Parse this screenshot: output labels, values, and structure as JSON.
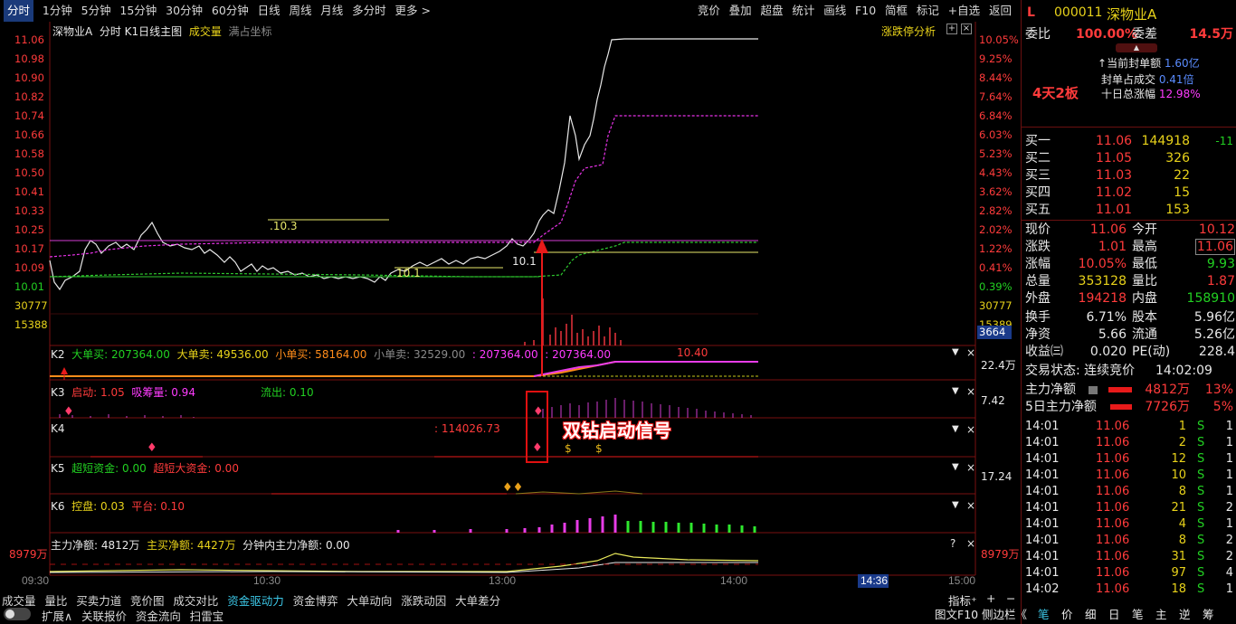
{
  "topbar": {
    "periods": [
      "分时",
      "1分钟",
      "5分钟",
      "15分钟",
      "30分钟",
      "60分钟",
      "日线",
      "周线",
      "月线",
      "多分时",
      "更多 >"
    ],
    "tools": [
      "竞价",
      "叠加",
      "超盘",
      "统计",
      "画线",
      "F10",
      "简框",
      "标记",
      "+自选",
      "返回"
    ]
  },
  "main": {
    "title_left": "深物业A",
    "title_mid": "分时  K1日线主图",
    "title_vol": "成交量",
    "title_coord": "满占坐标",
    "limit_analysis": "涨跌停分析",
    "price_ticks": [
      "11.06",
      "10.98",
      "10.90",
      "10.82",
      "10.74",
      "10.66",
      "10.58",
      "10.50",
      "10.41",
      "10.33",
      "10.25",
      "10.17",
      "10.09",
      "10.01"
    ],
    "pct_ticks": [
      "10.05%",
      "9.25%",
      "8.44%",
      "7.64%",
      "6.84%",
      "6.03%",
      "5.23%",
      "4.43%",
      "3.62%",
      "2.82%",
      "2.02%",
      "1.22%",
      "0.41%",
      "0.39%"
    ],
    "vol_ticks_left": [
      "30777",
      "15388"
    ],
    "vol_ticks_right": [
      "30777",
      "15389"
    ],
    "annot_1": ".10.3",
    "annot_2": "10.1",
    "annot_3": "10.1"
  },
  "panels": {
    "k2": {
      "label": "K2",
      "big_buy": "大单买: 207364.00",
      "big_sell": "大单卖: 49536.00",
      "small_buy": "小单买: 58164.00",
      "small_sell": "小单卖: 32529.00",
      "v1": ": 207364.00",
      "v2": ": 207364.00",
      "v3": "10.40",
      "right": "22.4万"
    },
    "k3": {
      "label": "K3",
      "start": "启动: 1.05",
      "absorb": "吸筹量: 0.94",
      "outflow": "流出: 0.10",
      "right": "7.42"
    },
    "k4": {
      "label": "K4",
      "val": ": 114026.73",
      "signal": "双钻启动信号"
    },
    "k5": {
      "label": "K5",
      "ultra": "超短资金: 0.00",
      "ultra_big": "超短大资金: 0.00",
      "right": "17.24"
    },
    "k6": {
      "label": "K6",
      "control": "控盘: 0.03",
      "platform": "平台: 0.10"
    },
    "main_flow": {
      "left": "8979万",
      "net": "主力净额: 4812万",
      "buy": "主买净额: 4427万",
      "minute": "分钟内主力净额: 0.00",
      "right": "8979万"
    },
    "k3_box_value": "3664"
  },
  "time_axis": [
    "09:30",
    "10:30",
    "13:00",
    "14:00",
    "15:00"
  ],
  "time_cursor": "14:36",
  "bottom": {
    "tabs1": [
      "成交量",
      "量比",
      "买卖力道",
      "竞价图",
      "成交对比",
      "资金驱动力",
      "资金博弈",
      "大单动向",
      "涨跌动因",
      "大单差分"
    ],
    "active_tab": "资金驱动力",
    "indicator": "指标⁺",
    "tabs2": [
      "扩展∧",
      "关联报价",
      "资金流向",
      "扫雷宝"
    ]
  },
  "right_panel": {
    "market": "L",
    "code": "000011",
    "name": "深物业A",
    "weibi_label": "委比",
    "weibi": "100.00%",
    "weicha_label": "委差",
    "weicha": "14.5万",
    "seal_label": "当前封单额",
    "seal": "1.60亿",
    "seal_ratio_label": "封单占成交",
    "seal_ratio": "0.41倍",
    "ten_day_label": "十日总涨幅",
    "ten_day": "12.98%",
    "board": "4天2板",
    "bids": [
      {
        "label": "买一",
        "price": "11.06",
        "vol": "144918",
        "chg": "-11"
      },
      {
        "label": "买二",
        "price": "11.05",
        "vol": "326",
        "chg": ""
      },
      {
        "label": "买三",
        "price": "11.03",
        "vol": "22",
        "chg": ""
      },
      {
        "label": "买四",
        "price": "11.02",
        "vol": "15",
        "chg": ""
      },
      {
        "label": "买五",
        "price": "11.01",
        "vol": "153",
        "chg": ""
      }
    ],
    "stats": [
      {
        "l1": "现价",
        "v1": "11.06",
        "l2": "今开",
        "v2": "10.12"
      },
      {
        "l1": "涨跌",
        "v1": "1.01",
        "l2": "最高",
        "v2": "11.06"
      },
      {
        "l1": "涨幅",
        "v1": "10.05%",
        "l2": "最低",
        "v2": "9.93"
      },
      {
        "l1": "总量",
        "v1": "353128",
        "l2": "量比",
        "v2": "1.87"
      },
      {
        "l1": "外盘",
        "v1": "194218",
        "l2": "内盘",
        "v2": "158910"
      },
      {
        "l1": "换手",
        "v1": "6.71%",
        "l2": "股本",
        "v2": "5.96亿"
      },
      {
        "l1": "净资",
        "v1": "5.66",
        "l2": "流通",
        "v2": "5.26亿"
      },
      {
        "l1": "收益㈢",
        "v1": "0.020",
        "l2": "PE(动)",
        "v2": "228.4"
      }
    ],
    "trade_status": "交易状态: 连续竞价",
    "trade_time": "14:02:09",
    "main_net_label": "主力净额",
    "main_net": "4812万",
    "main_net_pct": "13%",
    "five_net_label": "5日主力净额",
    "five_net": "7726万",
    "five_net_pct": "5%",
    "ticks": [
      {
        "t": "14:01",
        "p": "11.06",
        "v": "1",
        "s": "S",
        "n": "1"
      },
      {
        "t": "14:01",
        "p": "11.06",
        "v": "2",
        "s": "S",
        "n": "1"
      },
      {
        "t": "14:01",
        "p": "11.06",
        "v": "12",
        "s": "S",
        "n": "1"
      },
      {
        "t": "14:01",
        "p": "11.06",
        "v": "10",
        "s": "S",
        "n": "1"
      },
      {
        "t": "14:01",
        "p": "11.06",
        "v": "8",
        "s": "S",
        "n": "1"
      },
      {
        "t": "14:01",
        "p": "11.06",
        "v": "21",
        "s": "S",
        "n": "2"
      },
      {
        "t": "14:01",
        "p": "11.06",
        "v": "4",
        "s": "S",
        "n": "1"
      },
      {
        "t": "14:01",
        "p": "11.06",
        "v": "8",
        "s": "S",
        "n": "2"
      },
      {
        "t": "14:01",
        "p": "11.06",
        "v": "31",
        "s": "S",
        "n": "2"
      },
      {
        "t": "14:01",
        "p": "11.06",
        "v": "97",
        "s": "S",
        "n": "4"
      },
      {
        "t": "14:02",
        "p": "11.06",
        "v": "18",
        "s": "S",
        "n": "1"
      }
    ],
    "footer": [
      "图文F10",
      "侧边栏《",
      "笔",
      "价",
      "细",
      "日",
      "笔",
      "主",
      "逆",
      "筹"
    ]
  }
}
